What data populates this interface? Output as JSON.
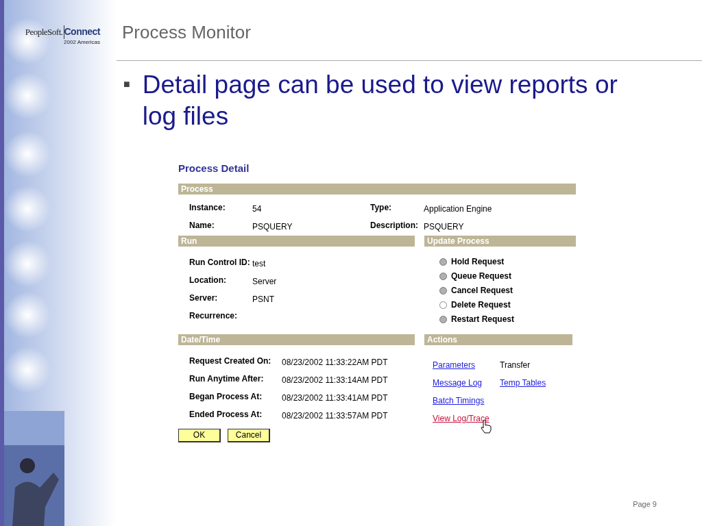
{
  "logo": {
    "brand": "PeopleSoft.",
    "product": "Connect",
    "subtitle": "2002 Americas"
  },
  "slide": {
    "title": "Process Monitor",
    "bullet": "■",
    "bullet_text": "Detail page can be used to view reports or log files",
    "page": "Page 9"
  },
  "screen": {
    "title": "Process Detail",
    "process": {
      "header": "Process",
      "fields": [
        {
          "label": "Instance:",
          "value": "54"
        },
        {
          "label": "Type:",
          "value": "Application Engine"
        },
        {
          "label": "Name:",
          "value": "PSQUERY"
        },
        {
          "label": "Description:",
          "value": "PSQUERY"
        }
      ]
    },
    "run": {
      "header": "Run",
      "fields": [
        {
          "label": "Run Control ID:",
          "value": "test"
        },
        {
          "label": "Location:",
          "value": "Server"
        },
        {
          "label": "Server:",
          "value": "PSNT"
        },
        {
          "label": "Recurrence:"
        }
      ]
    },
    "update_process": {
      "header": "Update Process",
      "options": [
        {
          "label": "Hold Request",
          "selected": false,
          "disabled": true
        },
        {
          "label": "Queue Request",
          "selected": false,
          "disabled": true
        },
        {
          "label": "Cancel Request",
          "selected": false,
          "disabled": true
        },
        {
          "label": "Delete Request",
          "selected": false,
          "disabled": false
        },
        {
          "label": "Restart Request",
          "selected": false,
          "disabled": true
        }
      ]
    },
    "date_time": {
      "header": "Date/Time",
      "fields": [
        {
          "label": "Request Created On:",
          "value": "08/23/2002 11:33:22AM PDT"
        },
        {
          "label": "Run Anytime After:",
          "value": "08/23/2002 11:33:14AM PDT"
        },
        {
          "label": "Began Process At:",
          "value": "08/23/2002 11:33:41AM PDT"
        },
        {
          "label": "Ended Process At:",
          "value": "08/23/2002 11:33:57AM PDT"
        }
      ]
    },
    "actions": {
      "header": "Actions",
      "rows": [
        [
          {
            "label": "Parameters",
            "kind": "link",
            "color": "#2020e0"
          },
          {
            "label": "Transfer",
            "kind": "text"
          }
        ],
        [
          {
            "label": "Message Log",
            "kind": "link",
            "color": "#2020e0"
          },
          {
            "label": "Temp Tables",
            "kind": "link",
            "color": "#2020e0"
          }
        ],
        [
          {
            "label": "Batch Timings",
            "kind": "link",
            "color": "#2020e0"
          }
        ],
        [
          {
            "label": "View Log/Trace",
            "kind": "link",
            "color": "#c8103c"
          }
        ]
      ]
    },
    "buttons": [
      "OK",
      "Cancel"
    ]
  }
}
